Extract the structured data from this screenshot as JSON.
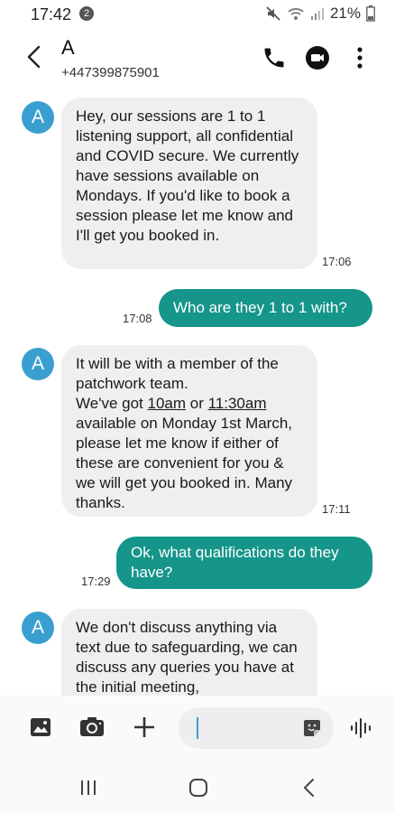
{
  "status_bar": {
    "time": "17:42",
    "notification_count": "2",
    "battery": "21%"
  },
  "header": {
    "contact_name": "A",
    "contact_number": "+447399875901"
  },
  "messages": [
    {
      "direction": "incoming",
      "avatar": "A",
      "text": "Hey, our sessions are 1 to 1 listening support, all confidential and COVID secure. We currently have sessions available on Mondays. If you'd like to book a session please let me know and I'll get you booked in.",
      "time": "17:06"
    },
    {
      "direction": "outgoing",
      "text": "Who are they 1 to 1 with?",
      "time": "17:08"
    },
    {
      "direction": "incoming",
      "avatar": "A",
      "text_parts": {
        "line_a": "It will be with a member of the patchwork team.",
        "pre": "We've got ",
        "link1": "10am",
        "mid": " or ",
        "link2": "11:30am",
        "post": " available on Monday 1st March, please let me know if either of these are convenient for you & we will get you booked in. Many thanks."
      },
      "time": "17:11"
    },
    {
      "direction": "outgoing",
      "text": "Ok, what qualifications do they have?",
      "time": "17:29"
    },
    {
      "direction": "incoming",
      "avatar": "A",
      "text": "We don't discuss anything via text due to safeguarding, we can discuss any queries you have at the initial meeting,"
    }
  ],
  "composer": {
    "input_value": ""
  },
  "colors": {
    "avatar_blue": "#3a9fd0",
    "outgoing_bubble": "#16958a",
    "incoming_bubble": "#efefef"
  },
  "icons": {
    "back": "back-arrow-icon",
    "call": "phone-icon",
    "video": "video-call-icon",
    "more": "more-vertical-icon",
    "gallery": "gallery-icon",
    "camera": "camera-icon",
    "add": "plus-icon",
    "sticker": "sticker-icon",
    "voice": "voice-wave-icon"
  }
}
